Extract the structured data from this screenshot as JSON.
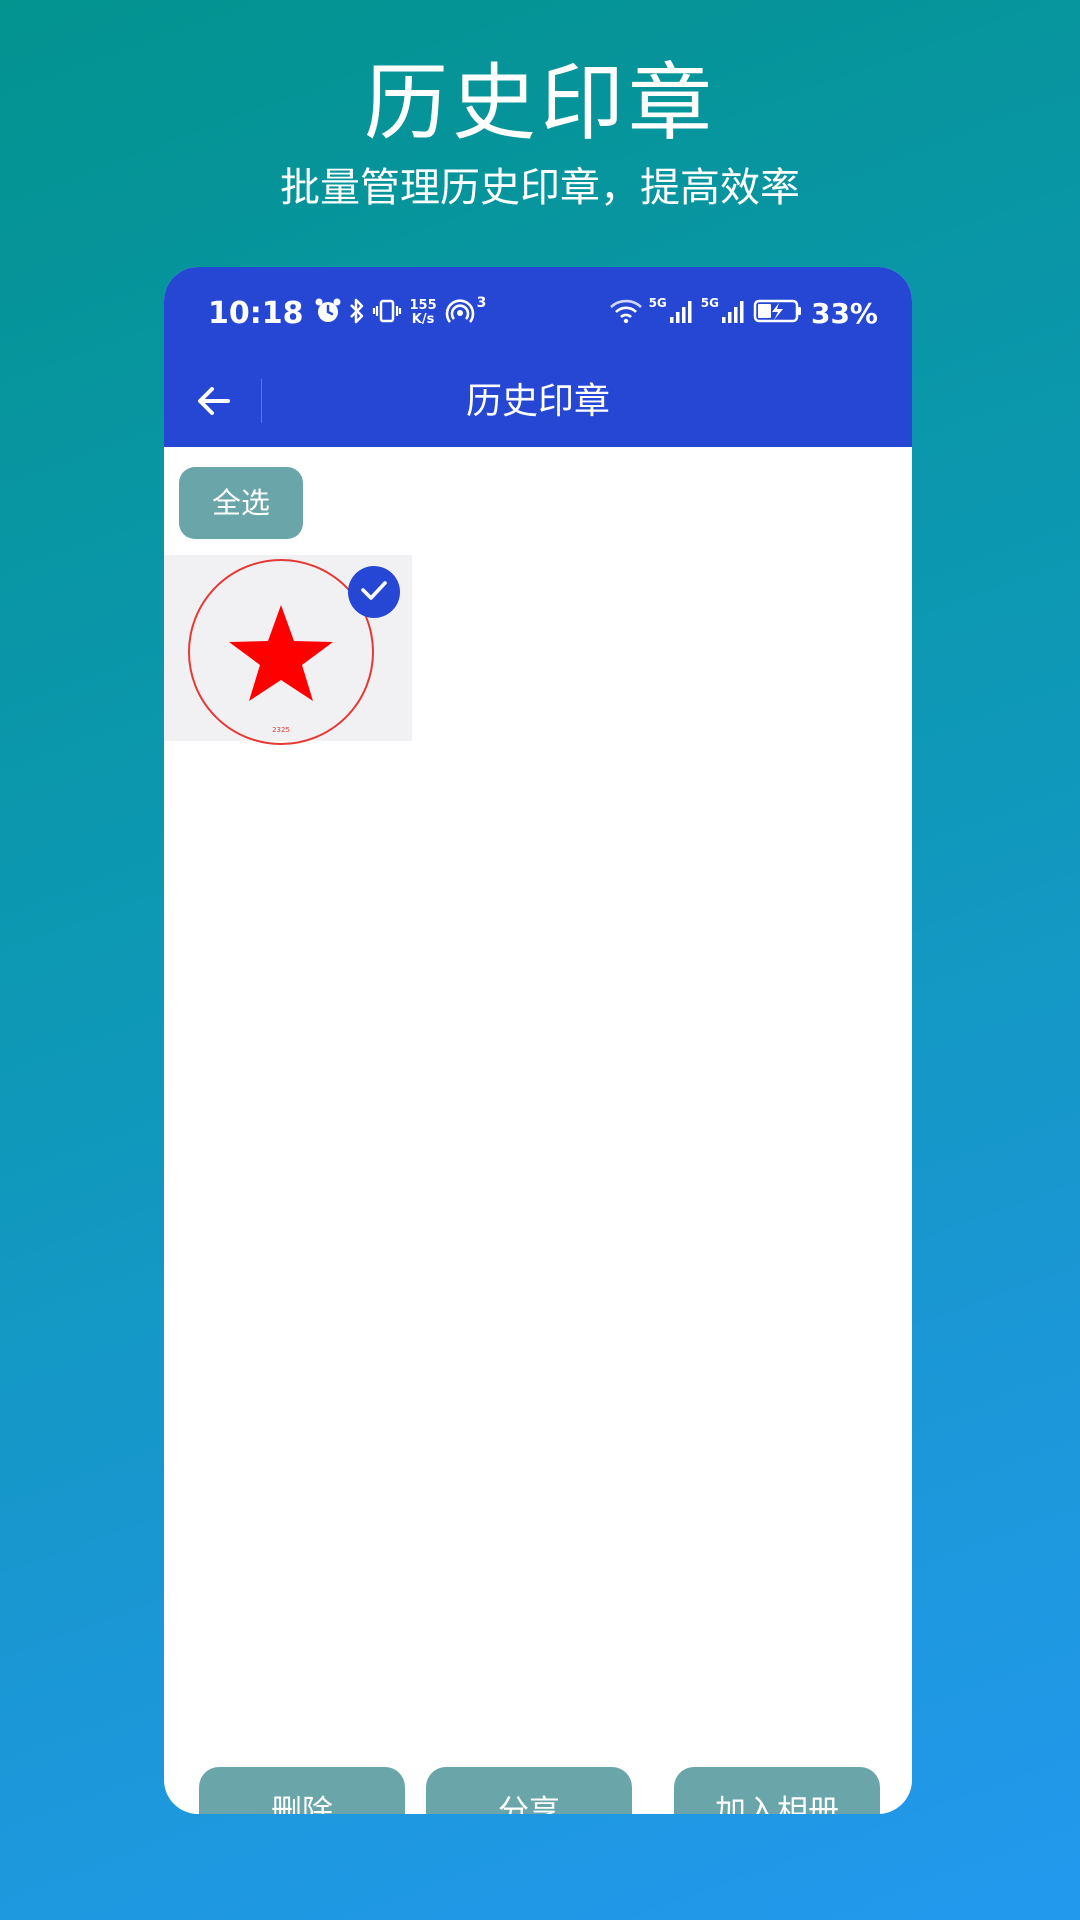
{
  "promo": {
    "title": "历史印章",
    "subtitle": "批量管理历史印章，提高效率"
  },
  "status_bar": {
    "time": "10:18",
    "net_speed_value": "155",
    "net_speed_unit": "K/s",
    "hotspot_count": "3",
    "sim1_label": "5G",
    "sim2_label": "5G",
    "battery_percent": "33%"
  },
  "app_bar": {
    "title": "历史印章"
  },
  "toolbar": {
    "select_all_label": "全选"
  },
  "seals": [
    {
      "selected": true,
      "caption": "2325",
      "seal_color": "#e53935",
      "star_color": "#ff0000"
    }
  ],
  "bottom_actions": {
    "delete_label": "删除",
    "share_label": "分享",
    "add_to_album_label": "加入相册"
  },
  "colors": {
    "primary": "#2647d4",
    "button": "#6aa6a9"
  }
}
